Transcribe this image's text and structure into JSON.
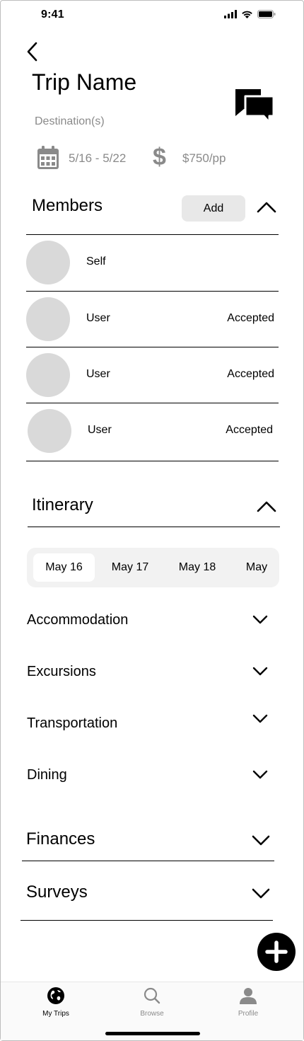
{
  "status_bar": {
    "time": "9:41"
  },
  "header": {
    "title": "Trip Name",
    "destination_placeholder": "Destination(s)",
    "dates": "5/16 - 5/22",
    "budget": "$750/pp",
    "currency_symbol": "$"
  },
  "members": {
    "title": "Members",
    "add_label": "Add",
    "rows": [
      {
        "name": "Self",
        "status": ""
      },
      {
        "name": "User",
        "status": "Accepted"
      },
      {
        "name": "User",
        "status": "Accepted"
      },
      {
        "name": "User",
        "status": "Accepted"
      }
    ]
  },
  "itinerary": {
    "title": "Itinerary",
    "days": [
      "May 16",
      "May 17",
      "May 18",
      "May"
    ],
    "selected_day": "May 16",
    "categories": [
      "Accommodation",
      "Excursions",
      "Transportation",
      "Dining"
    ]
  },
  "finances": {
    "title": "Finances"
  },
  "surveys": {
    "title": "Surveys"
  },
  "tabbar": {
    "tabs": [
      {
        "label": "My Trips",
        "icon": "globe-icon",
        "active": true
      },
      {
        "label": "Browse",
        "icon": "search-icon",
        "active": false
      },
      {
        "label": "Profile",
        "icon": "person-icon",
        "active": false
      }
    ]
  },
  "colors": {
    "active_tab": "#000000",
    "inactive_tab": "#8a8a8a",
    "muted_text": "#8a8a8a",
    "pill_bg": "#f2f2f2",
    "avatar": "#d9d9d9"
  }
}
